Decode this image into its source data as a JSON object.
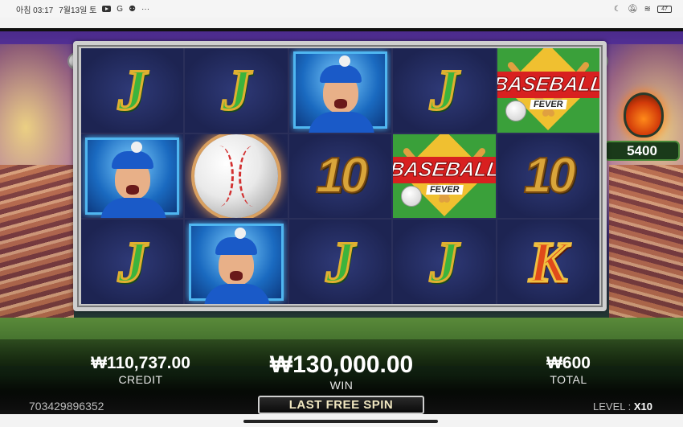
{
  "statusbar": {
    "time": "아침 03:17",
    "date": "7월13일 토",
    "g": "G",
    "dots": "···",
    "battery": "47"
  },
  "reels": [
    [
      "J",
      "pitcher",
      "J"
    ],
    [
      "J",
      "ball",
      "pitcher"
    ],
    [
      "pitcher",
      "10",
      "J"
    ],
    [
      "J",
      "baseball-fever",
      "J"
    ],
    [
      "baseball-fever",
      "10",
      "K"
    ]
  ],
  "logo": {
    "word": "BASEBALL",
    "sub": "FEVER"
  },
  "multiplier": {
    "value": "5400"
  },
  "bottom": {
    "credit_value": "₩110,737.00",
    "credit_label": "CREDIT",
    "win_value": "₩130,000.00",
    "win_label": "WIN",
    "total_value": "₩600",
    "total_label": "TOTAL",
    "game_id": "703429896352",
    "last_spin": "LAST FREE SPIN",
    "level_label": "LEVEL :",
    "level_value": "X10"
  }
}
